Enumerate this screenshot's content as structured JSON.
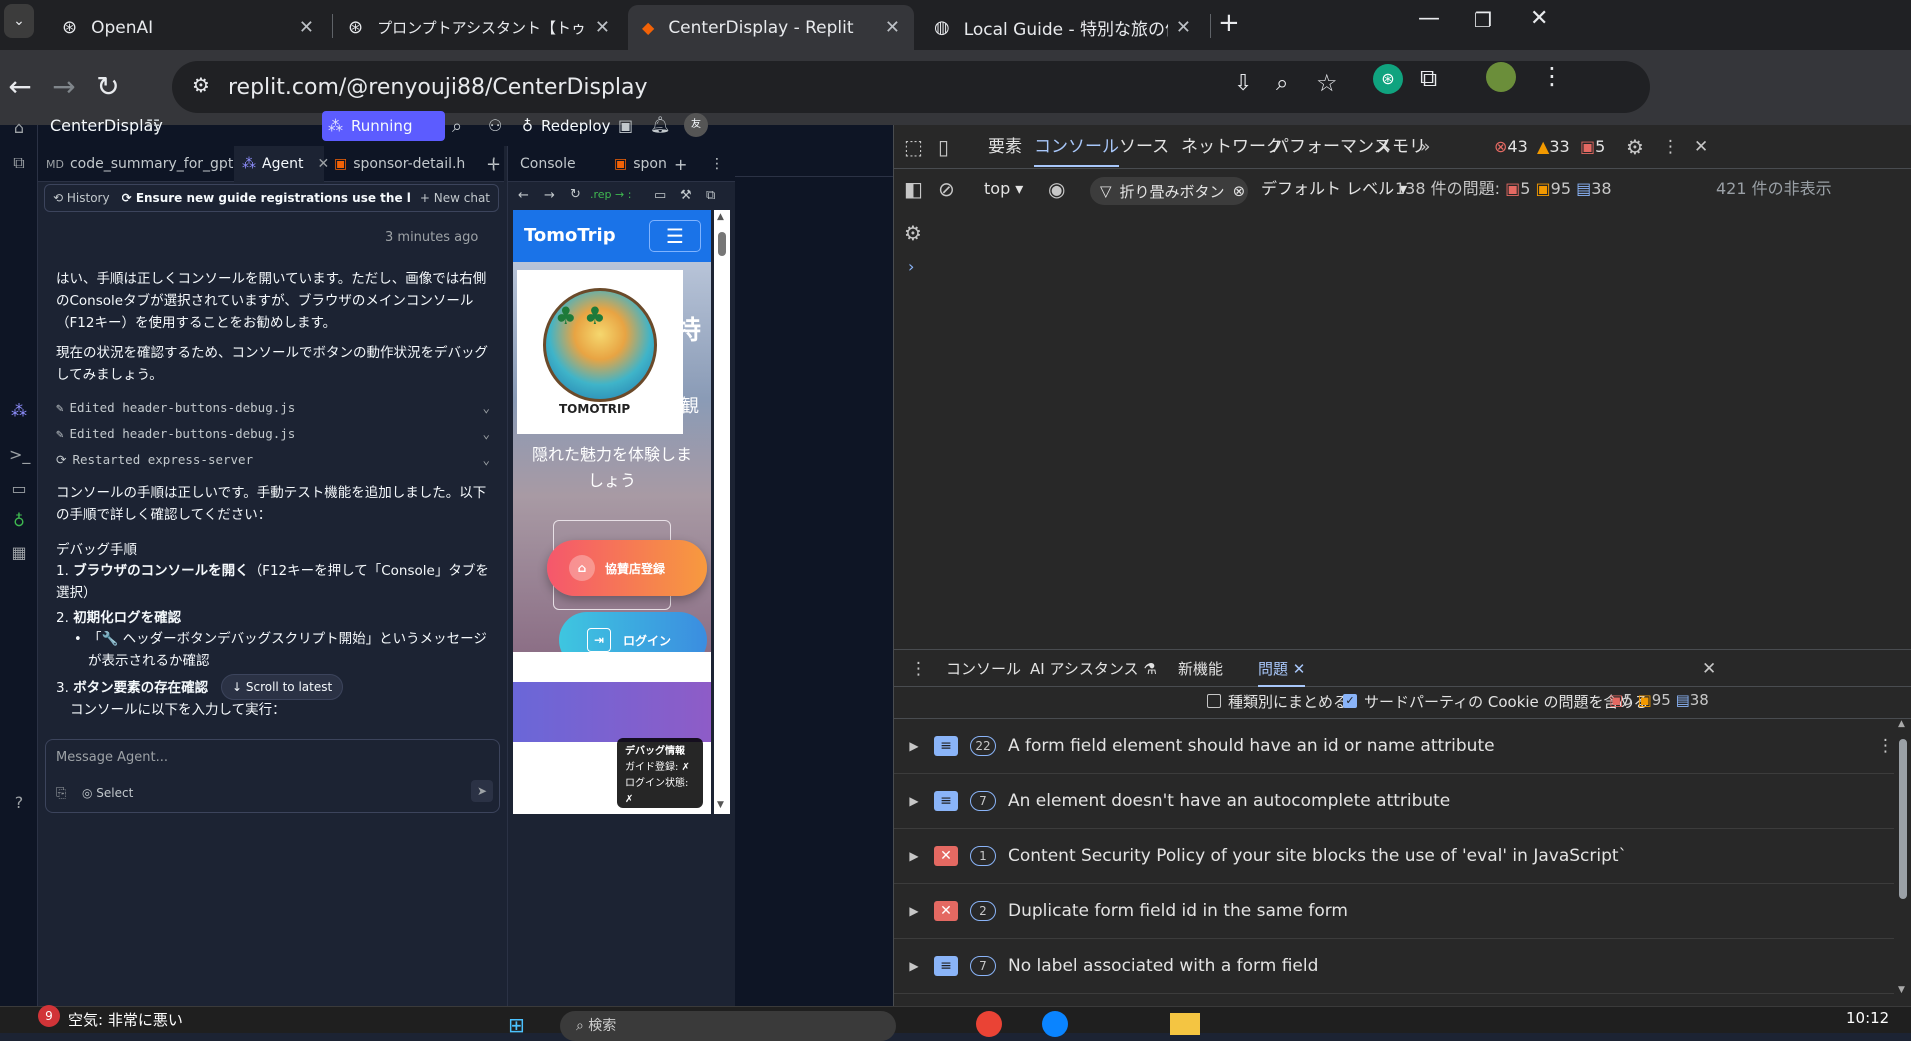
{
  "browser": {
    "tabs": [
      {
        "title": "OpenAI",
        "icon": "openai-icon"
      },
      {
        "title": "プロンプトアシスタント【トゥモローブル",
        "icon": "openai-icon"
      },
      {
        "title": "CenterDisplay - Replit",
        "icon": "replit-icon"
      },
      {
        "title": "Local Guide - 特別な旅の体験を",
        "icon": "globe-icon"
      }
    ],
    "url": "replit.com/@renyouji88/CenterDisplay"
  },
  "replit": {
    "project_name": "CenterDisplay",
    "run_label": "Running",
    "redeploy_label": "Redeploy",
    "avatar_text": "友",
    "tabs": [
      {
        "label": "code_summary_for_gpt.md"
      },
      {
        "label": "Agent"
      },
      {
        "label": "sponsor-detail.h"
      }
    ],
    "history_label": "History",
    "chat_title": "Ensure new guide registrations use the latest informat...",
    "new_chat_label": "New chat",
    "time_ago": "3 minutes ago",
    "messages": [
      "はい、手順は正しくコンソールを開いています。ただし、画像では右側のConsoleタブが選択されていますが、ブラウザのメインコンソール（F12キー）を使用することをお勧めします。",
      "現在の状況を確認するため、コンソールでボタンの動作状況をデバッグしてみましょう。"
    ],
    "actions": [
      "Edited header-buttons-debug.js",
      "Edited header-buttons-debug.js",
      "Restarted express-server"
    ],
    "message3": "コンソールの手順は正しいです。手動テスト機能を追加しました。以下の手順で詳しく確認してください：",
    "debug_heading": "デバッグ手順",
    "steps": [
      {
        "num": "1.",
        "bold": "ブラウザのコンソールを開く",
        "rest": "（F12キーを押して「Console」タブを選択）"
      },
      {
        "num": "2.",
        "bold": "初期化ログを確認",
        "rest": ""
      },
      {
        "num": "3.",
        "bold": "ボタン要素の存在確認",
        "rest": ""
      }
    ],
    "bullet": "「🔧 ヘッダーボタンデバッグスクリプト開始」というメッセージが表示されるか確認",
    "step3_sub": "コンソールに以下を入力して実行：",
    "scroll_latest": "Scroll to latest",
    "input_placeholder": "Message Agent...",
    "select_label": "Select",
    "preview": {
      "tabs": [
        {
          "label": "Console"
        },
        {
          "label": "spons"
        }
      ],
      "url": ".rep → :",
      "brand": "TomoTrip",
      "logo_text": "TOMOTRIP",
      "hero_text": "隠れた魅力を体験しましょう",
      "partial_char": "特",
      "partial_char2": "観",
      "sponsor_btn": "協賛店登録",
      "login_btn": "ログイン",
      "debug_title": "デバッグ情報",
      "debug_guide": "ガイド登録: ✗",
      "debug_login": "ログイン状態: ✗"
    }
  },
  "devtools": {
    "tabs": [
      "要素",
      "コンソール",
      "ソース",
      "ネットワーク",
      "パフォーマンス",
      "メモリ"
    ],
    "errors": "43",
    "warnings": "33",
    "issues_top": "5",
    "context": "top",
    "filter": "折り畳みボタン",
    "level": "デフォルト レベル",
    "problems_label": "138 件の問題:",
    "p_err": "5",
    "p_warn": "95",
    "p_info": "38",
    "hidden": "421 件の非表示",
    "drawer_tabs": [
      "コンソール",
      "AI アシスタンス",
      "新機能",
      "問題"
    ],
    "group_label": "種類別にまとめる",
    "thirdparty_label": "サードパーティの Cookie の問題を含める",
    "issues": [
      {
        "type": "info",
        "count": "22",
        "text": "A form field element should have an id or name attribute"
      },
      {
        "type": "info",
        "count": "7",
        "text": "An element doesn't have an autocomplete attribute"
      },
      {
        "type": "error",
        "count": "1",
        "text": "Content Security Policy of your site blocks the use of 'eval' in JavaScript`"
      },
      {
        "type": "error",
        "count": "2",
        "text": "Duplicate form field id in the same form"
      },
      {
        "type": "info",
        "count": "7",
        "text": "No label associated with a form field"
      }
    ]
  },
  "taskbar": {
    "weather_badge": "9",
    "weather": "空気: 非常に悪い",
    "search": "検索",
    "time": "10:12"
  },
  "colors": {
    "replit_accent": "#5c5cff",
    "error": "#e46962",
    "warning": "#f29900",
    "info": "#8ab4f8"
  }
}
